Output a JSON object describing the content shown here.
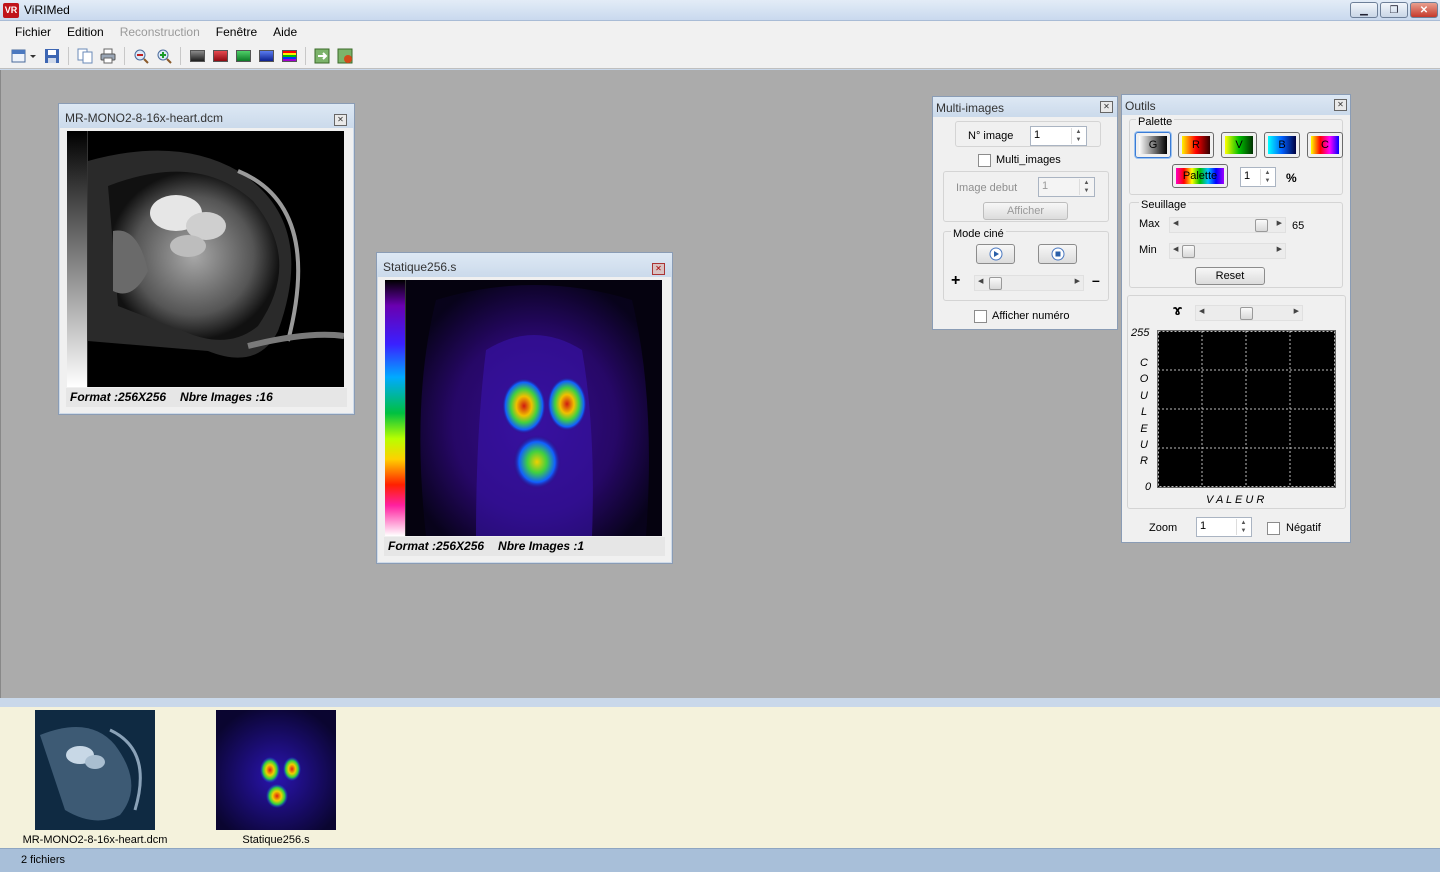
{
  "window": {
    "title": "ViRIMed",
    "icon_text": "VR"
  },
  "menu": [
    {
      "label": "Fichier",
      "enabled": true
    },
    {
      "label": "Edition",
      "enabled": true
    },
    {
      "label": "Reconstruction",
      "enabled": false
    },
    {
      "label": "Fenêtre",
      "enabled": true
    },
    {
      "label": "Aide",
      "enabled": true
    }
  ],
  "toolbar": {
    "swatch_colors": [
      "#2a2a2a",
      "#c1121b",
      "#1aa33a",
      "#1a3cc8"
    ]
  },
  "windows": {
    "mr": {
      "title": "MR-MONO2-8-16x-heart.dcm",
      "format": "Format :256X256",
      "count": "Nbre Images :16"
    },
    "stat": {
      "title": "Statique256.s",
      "format": "Format :256X256",
      "count": "Nbre Images :1"
    }
  },
  "multi": {
    "title": "Multi-images",
    "n_image_label": "N° image",
    "n_image_value": "1",
    "multi_images_label": "Multi_images",
    "image_debut_label": "Image debut",
    "image_debut_value": "1",
    "afficher_label": "Afficher",
    "mode_cine_label": "Mode ciné",
    "plus": "+",
    "minus": "–",
    "afficher_numero_label": "Afficher numéro"
  },
  "outils": {
    "title": "Outils",
    "palette_label": "Palette",
    "palettes": [
      "G",
      "R",
      "V",
      "B",
      "C"
    ],
    "palette_custom_label": "Palette",
    "palette_value": "1",
    "percent": "%",
    "seuillage_label": "Seuillage",
    "max_label": "Max",
    "max_value": "65",
    "min_label": "Min",
    "reset_label": "Reset",
    "gamma_symbol": "ɤ",
    "y_top": "255",
    "y_bottom": "0",
    "y_letters": [
      "C",
      "O",
      "U",
      "L",
      "E",
      "U",
      "R"
    ],
    "x_label": "V A L E U R",
    "zoom_label": "Zoom",
    "zoom_value": "1",
    "negatif_label": "Négatif"
  },
  "thumbnails": [
    {
      "caption": "MR-MONO2-8-16x-heart.dcm"
    },
    {
      "caption": "Statique256.s"
    }
  ],
  "status": {
    "text": "2 fichiers"
  }
}
